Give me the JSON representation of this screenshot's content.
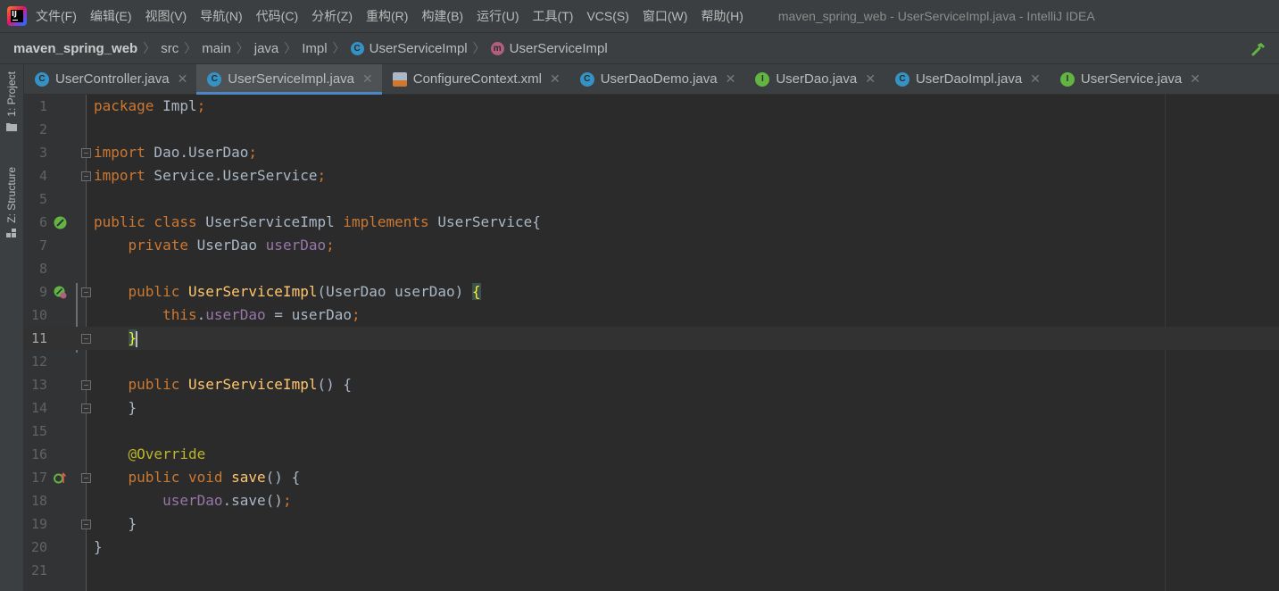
{
  "menubar": {
    "items": [
      "文件(F)",
      "编辑(E)",
      "视图(V)",
      "导航(N)",
      "代码(C)",
      "分析(Z)",
      "重构(R)",
      "构建(B)",
      "运行(U)",
      "工具(T)",
      "VCS(S)",
      "窗口(W)",
      "帮助(H)"
    ],
    "window_title": "maven_spring_web - UserServiceImpl.java - IntelliJ IDEA"
  },
  "breadcrumb": {
    "items": [
      "maven_spring_web",
      "src",
      "main",
      "java",
      "Impl",
      "UserServiceImpl",
      "UserServiceImpl"
    ],
    "icons": [
      "",
      "",
      "",
      "",
      "",
      "class-icon",
      "method-icon"
    ]
  },
  "left_stripe": {
    "project_label": "1: Project",
    "structure_label": "Z: Structure"
  },
  "tabs": [
    {
      "label": "UserController.java",
      "icon": "class-icon",
      "active": false
    },
    {
      "label": "UserServiceImpl.java",
      "icon": "class-icon",
      "active": true
    },
    {
      "label": "ConfigureContext.xml",
      "icon": "xml-file-icon",
      "active": false
    },
    {
      "label": "UserDaoDemo.java",
      "icon": "class-icon",
      "active": false
    },
    {
      "label": "UserDao.java",
      "icon": "interface-icon",
      "active": false
    },
    {
      "label": "UserDaoImpl.java",
      "icon": "class-icon",
      "active": false
    },
    {
      "label": "UserService.java",
      "icon": "interface-icon",
      "active": false
    }
  ],
  "editor": {
    "current_line": 11,
    "line_numbers": [
      "1",
      "2",
      "3",
      "4",
      "5",
      "6",
      "7",
      "8",
      "9",
      "10",
      "11",
      "12",
      "13",
      "14",
      "15",
      "16",
      "17",
      "18",
      "19",
      "20",
      "21"
    ],
    "code": {
      "l1_kw": "package",
      "l1_rest": " Impl",
      "l1_semi": ";",
      "l3_kw": "import",
      "l3_rest": " Dao.UserDao",
      "l3_semi": ";",
      "l4_kw": "import",
      "l4_rest": " Service.UserService",
      "l4_semi": ";",
      "l6_kw1": "public class",
      "l6_name": " UserServiceImpl ",
      "l6_kw2": "implements",
      "l6_rest": " UserService{",
      "l7_indent": "    ",
      "l7_kw": "private",
      "l7_type": " UserDao ",
      "l7_field": "userDao",
      "l7_semi": ";",
      "l9_indent": "    ",
      "l9_kw": "public",
      "l9_sp": " ",
      "l9_method": "UserServiceImpl",
      "l9_rest": "(UserDao userDao) ",
      "l9_brace": "{",
      "l10_indent": "        ",
      "l10_kw": "this",
      "l10_dot": ".",
      "l10_field": "userDao",
      "l10_rest": " = userDao",
      "l10_semi": ";",
      "l11_indent": "    ",
      "l11_brace": "}",
      "l13_indent": "    ",
      "l13_kw": "public",
      "l13_sp": " ",
      "l13_method": "UserServiceImpl",
      "l13_rest": "() {",
      "l14_indent": "    ",
      "l14_rest": "}",
      "l16_indent": "    ",
      "l16_ann": "@Override",
      "l17_indent": "    ",
      "l17_kw": "public void",
      "l17_sp": " ",
      "l17_method": "save",
      "l17_rest": "() {",
      "l18_indent": "        ",
      "l18_field": "userDao",
      "l18_rest": ".save()",
      "l18_semi": ";",
      "l19_indent": "    ",
      "l19_rest": "}",
      "l20_rest": "}"
    }
  },
  "colors": {
    "keyword": "#cc7832",
    "field": "#9876aa",
    "method": "#ffc66d",
    "annotation": "#bbb529",
    "text": "#a9b7c6",
    "accent": "#4a88c7"
  }
}
